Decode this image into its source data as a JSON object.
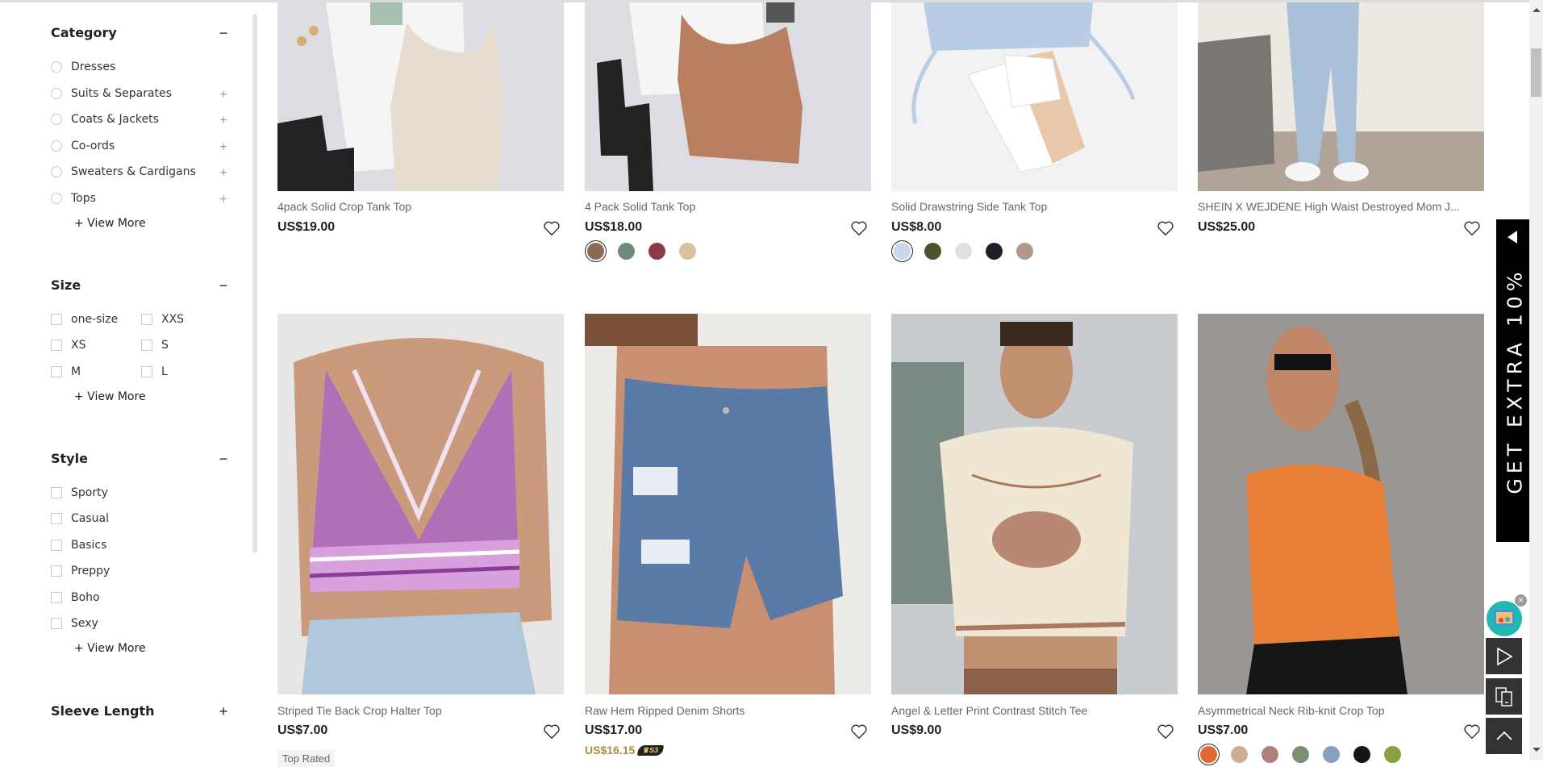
{
  "filters": {
    "category": {
      "title": "Category",
      "toggle": "−",
      "items": [
        {
          "label": "Dresses",
          "expandable": false
        },
        {
          "label": "Suits & Separates",
          "expandable": true
        },
        {
          "label": "Coats & Jackets",
          "expandable": true
        },
        {
          "label": "Co-ords",
          "expandable": true
        },
        {
          "label": "Sweaters & Cardigans",
          "expandable": true
        },
        {
          "label": "Tops",
          "expandable": true
        }
      ],
      "view_more": "+ View More",
      "plus": "+"
    },
    "size": {
      "title": "Size",
      "toggle": "−",
      "items": [
        "one-size",
        "XXS",
        "XS",
        "S",
        "M",
        "L"
      ],
      "view_more": "+ View More"
    },
    "style": {
      "title": "Style",
      "toggle": "−",
      "items": [
        "Sporty",
        "Casual",
        "Basics",
        "Preppy",
        "Boho",
        "Sexy"
      ],
      "view_more": "+ View More"
    },
    "sleeve_length": {
      "title": "Sleeve Length",
      "toggle": "+"
    }
  },
  "products": [
    {
      "name": "4pack Solid Crop Tank Top",
      "price": "US$19.00",
      "swatches": []
    },
    {
      "name": "4 Pack Solid Tank Top",
      "price": "US$18.00",
      "swatches": [
        "#8a6a58",
        "#6e8a78",
        "#8a3a48",
        "#d8c0a0"
      ]
    },
    {
      "name": "Solid Drawstring Side Tank Top",
      "price": "US$8.00",
      "swatches": [
        "#c5d8ec",
        "#4a5530",
        "#e0e0e0",
        "#1e2028",
        "#b09888"
      ]
    },
    {
      "name": "SHEIN X WEJDENE High Waist Destroyed Mom J...",
      "price": "US$25.00",
      "swatches": []
    },
    {
      "name": "Striped Tie Back Crop Halter Top",
      "price": "US$7.00",
      "badge": "Top Rated",
      "swatches": []
    },
    {
      "name": "Raw Hem Ripped Denim Shorts",
      "price": "US$17.00",
      "member_price": "US$16.15",
      "member_badge": "♛S3",
      "swatches": []
    },
    {
      "name": "Angel & Letter Print Contrast Stitch Tee",
      "price": "US$9.00",
      "swatches": []
    },
    {
      "name": "Asymmetrical Neck Rib-knit Crop Top",
      "price": "US$7.00",
      "swatches": [
        "#e06a30",
        "#d0ac90",
        "#b08078",
        "#7a9070",
        "#88a0c0",
        "#151515",
        "#88a040"
      ]
    }
  ],
  "promo": {
    "text": "GET EXTRA 10%"
  }
}
